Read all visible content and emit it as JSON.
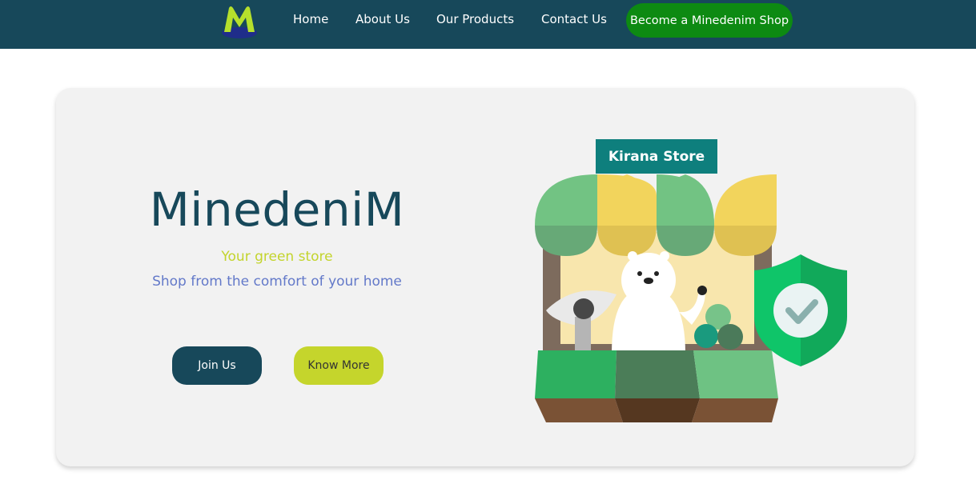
{
  "nav": {
    "links": [
      "Home",
      "About Us",
      "Our Products",
      "Contact Us"
    ],
    "cta_label": "Become a Minedenim Shop"
  },
  "hero": {
    "title": "MinedeniM",
    "tagline": "Your green store",
    "subtagline": "Shop from the comfort of your home",
    "join_label": "Join Us",
    "know_label": "Know More",
    "store_sign": "Kirana Store"
  },
  "colors": {
    "navbar_bg": "#17485a",
    "cta_bg": "#0d8a12",
    "title_color": "#17485a",
    "tagline_color": "#c3d42c",
    "subtagline_color": "#6379c9",
    "join_bg": "#17485a",
    "know_bg": "#c5d52c"
  }
}
